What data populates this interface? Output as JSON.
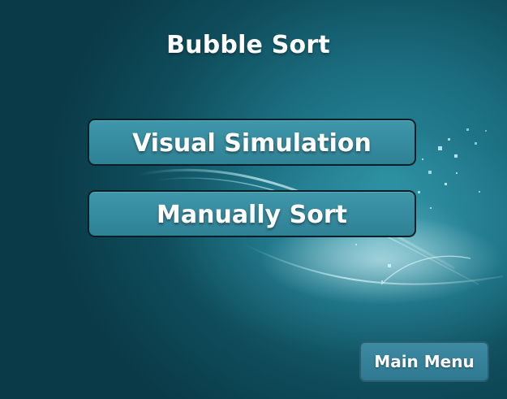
{
  "title": "Bubble Sort",
  "buttons": {
    "visual_simulation": "Visual Simulation",
    "manually_sort": "Manually Sort",
    "main_menu": "Main Menu"
  },
  "colors": {
    "background_dark": "#0b3f4c",
    "background_glow": "#2a8a9c",
    "button_fill": "#3a8fa3",
    "button_border": "#0a1f26",
    "text": "#ffffff"
  }
}
